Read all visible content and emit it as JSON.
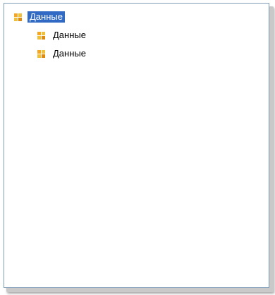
{
  "tree": {
    "nodes": [
      {
        "label": "Данные",
        "level": 0,
        "selected": true
      },
      {
        "label": "Данные",
        "level": 1,
        "selected": false
      },
      {
        "label": "Данные",
        "level": 1,
        "selected": false
      }
    ]
  },
  "colors": {
    "selection_bg": "#316ac5",
    "selection_text": "#ffffff",
    "border": "#7f9db9",
    "icon": "#f5a623"
  },
  "icons": {
    "node_icon": "data-folder-icon"
  }
}
